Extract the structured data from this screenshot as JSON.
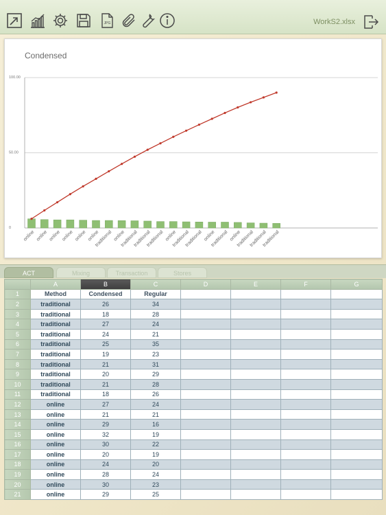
{
  "toolbar": {
    "icons": [
      "expand-icon",
      "chart-icon",
      "gear-icon",
      "save-icon",
      "jpg-file-icon",
      "paperclip-icon",
      "wrench-icon",
      "info-icon"
    ],
    "filename": "WorkS2.xlsx",
    "exit_icon": "exit-icon"
  },
  "chart_data": {
    "type": "bar+line",
    "title": "Condensed",
    "categories": [
      "online",
      "online",
      "online",
      "online",
      "online",
      "online",
      "traditional",
      "online",
      "traditional",
      "traditional",
      "traditional",
      "online",
      "traditional",
      "traditional",
      "online",
      "traditional",
      "online",
      "traditional",
      "traditional",
      "traditional"
    ],
    "series": [
      {
        "type": "bar",
        "values": [
          6.1,
          5.6,
          5.4,
          5.4,
          5.2,
          5.0,
          5.0,
          4.9,
          4.8,
          4.6,
          4.3,
          4.3,
          4.1,
          4.0,
          3.9,
          3.9,
          3.7,
          3.4,
          3.2,
          3.1
        ]
      },
      {
        "type": "line",
        "values": [
          6.1,
          11.7,
          17.1,
          22.5,
          27.7,
          32.7,
          37.7,
          42.6,
          47.4,
          52.0,
          56.3,
          60.6,
          64.7,
          68.7,
          72.6,
          76.5,
          80.2,
          83.6,
          86.8,
          90.0
        ]
      }
    ],
    "ylim": [
      0,
      100
    ],
    "yticks": [
      "0",
      "50.00",
      "100.00"
    ],
    "grid": true
  },
  "tabs": [
    {
      "label": "ACT",
      "active": true
    },
    {
      "label": "Mixing",
      "active": false
    },
    {
      "label": "Transaction",
      "active": false
    },
    {
      "label": "Stores",
      "active": false
    }
  ],
  "sheet": {
    "columns": [
      "A",
      "B",
      "C",
      "D",
      "E",
      "F",
      "G"
    ],
    "selected_column": "B",
    "headers": [
      "Method",
      "Condensed",
      "Regular"
    ],
    "rows": [
      [
        "traditional",
        "26",
        "34"
      ],
      [
        "traditional",
        "18",
        "28"
      ],
      [
        "traditional",
        "27",
        "24"
      ],
      [
        "traditional",
        "24",
        "21"
      ],
      [
        "traditional",
        "25",
        "35"
      ],
      [
        "traditional",
        "19",
        "23"
      ],
      [
        "traditional",
        "21",
        "31"
      ],
      [
        "traditional",
        "20",
        "29"
      ],
      [
        "traditional",
        "21",
        "28"
      ],
      [
        "traditional",
        "18",
        "26"
      ],
      [
        "online",
        "27",
        "24"
      ],
      [
        "online",
        "21",
        "21"
      ],
      [
        "online",
        "29",
        "16"
      ],
      [
        "online",
        "32",
        "19"
      ],
      [
        "online",
        "30",
        "22"
      ],
      [
        "online",
        "20",
        "19"
      ],
      [
        "online",
        "24",
        "20"
      ],
      [
        "online",
        "28",
        "24"
      ],
      [
        "online",
        "30",
        "23"
      ],
      [
        "online",
        "29",
        "25"
      ]
    ]
  }
}
